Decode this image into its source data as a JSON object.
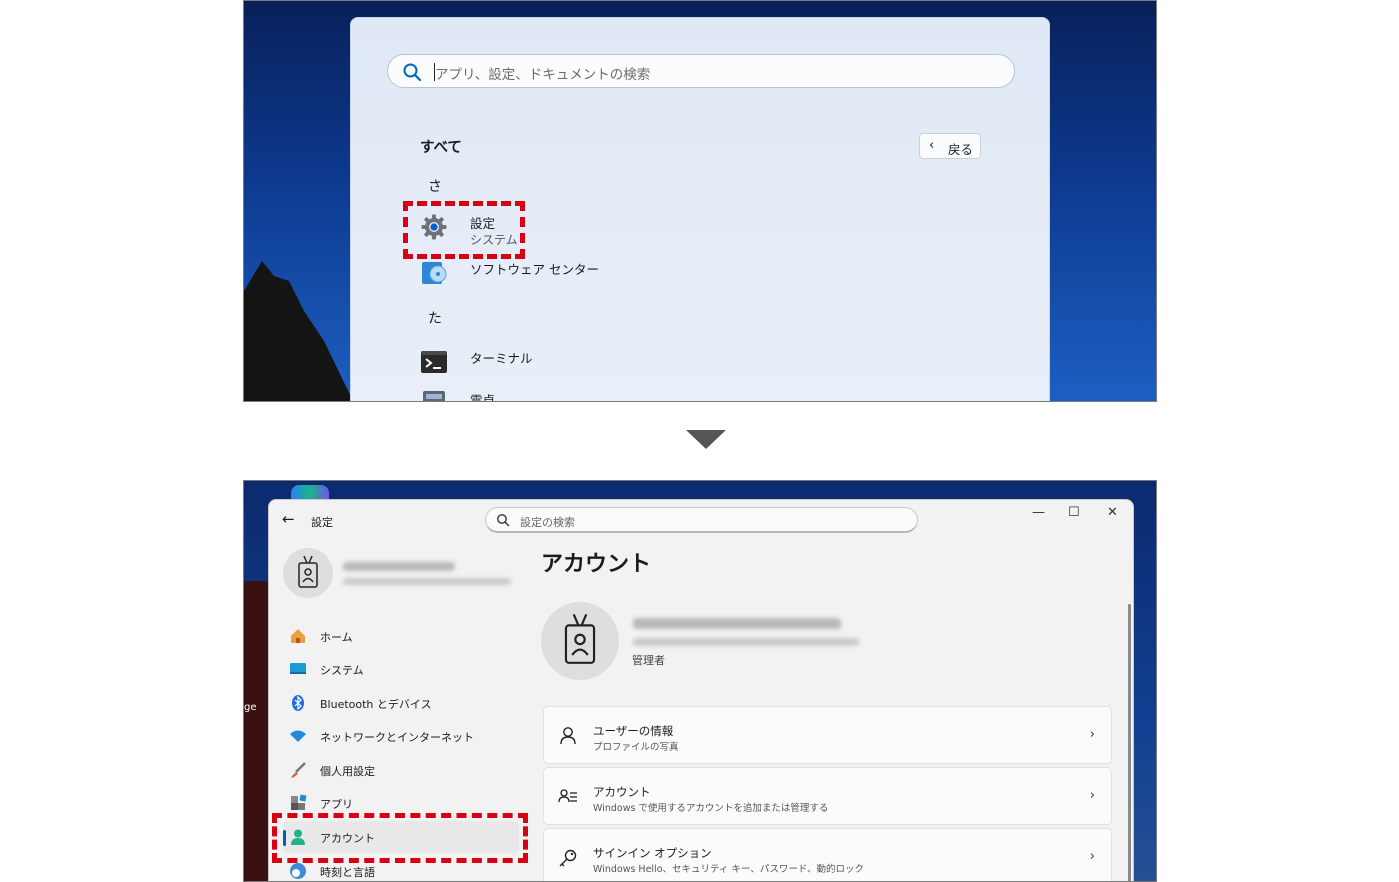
{
  "start_menu": {
    "search_placeholder": "アプリ、設定、ドキュメントの検索",
    "all_label": "すべて",
    "back_label": "戻る",
    "group_sa": "さ",
    "group_ta": "た",
    "apps": [
      {
        "name": "設定",
        "subtitle": "システム",
        "icon": "gear-icon"
      },
      {
        "name": "ソフトウェア センター",
        "icon": "software-center-icon"
      },
      {
        "name": "ターミナル",
        "icon": "terminal-icon"
      },
      {
        "name": "電卓",
        "icon": "calculator-icon"
      }
    ]
  },
  "settings": {
    "window_title": "設定",
    "search_placeholder": "設定の検索",
    "window_controls": {
      "minimize": "—",
      "maximize": "☐",
      "close": "✕"
    },
    "desktop_label": "ge",
    "nav": [
      {
        "label": "ホーム",
        "icon": "home-icon"
      },
      {
        "label": "システム",
        "icon": "system-icon"
      },
      {
        "label": "Bluetooth とデバイス",
        "icon": "bluetooth-icon"
      },
      {
        "label": "ネットワークとインターネット",
        "icon": "wifi-icon"
      },
      {
        "label": "個人用設定",
        "icon": "brush-icon"
      },
      {
        "label": "アプリ",
        "icon": "apps-icon"
      },
      {
        "label": "アカウント",
        "icon": "account-icon",
        "selected": true
      },
      {
        "label": "時刻と言語",
        "icon": "globe-clock-icon"
      }
    ],
    "page_title": "アカウント",
    "role": "管理者",
    "cards": [
      {
        "title": "ユーザーの情報",
        "subtitle": "プロファイルの写真",
        "icon": "user-info-icon"
      },
      {
        "title": "アカウント",
        "subtitle": "Windows で使用するアカウントを追加または管理する",
        "icon": "accounts-list-icon"
      },
      {
        "title": "サインイン オプション",
        "subtitle": "Windows Hello、セキュリティ キー、パスワード、動的ロック",
        "icon": "key-icon"
      }
    ]
  },
  "colors": {
    "highlight": "#d90012",
    "accent": "#005fb8"
  }
}
